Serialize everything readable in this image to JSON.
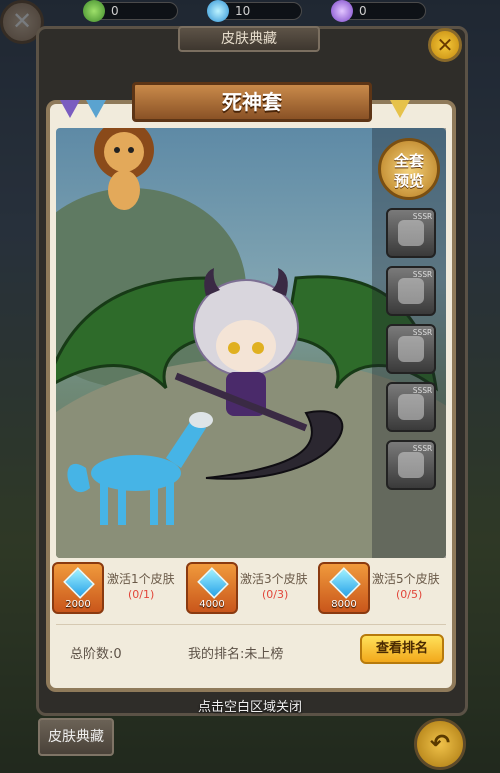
{
  "currencies": [
    {
      "icon": "clover-coin-icon",
      "value": "0"
    },
    {
      "icon": "diamond-icon",
      "value": "10"
    },
    {
      "icon": "purple-gem-icon",
      "value": "0"
    }
  ],
  "outer": {
    "title": "皮肤典藏"
  },
  "modal": {
    "title": "死神套"
  },
  "preview": {
    "label_line1": "全套",
    "label_line2": "预览"
  },
  "thumbs": [
    {
      "tag": "SSSR",
      "icon": "character-part-icon"
    },
    {
      "tag": "SSSR",
      "icon": "scythe-part-icon"
    },
    {
      "tag": "SSSR",
      "icon": "steed-part-icon"
    },
    {
      "tag": "SSSR",
      "icon": "wings-part-icon"
    },
    {
      "tag": "SSSR",
      "icon": "bear-part-icon"
    }
  ],
  "rewards": [
    {
      "amount": "2000",
      "label": "激活1个皮肤",
      "progress": "(0/1)"
    },
    {
      "amount": "4000",
      "label": "激活3个皮肤",
      "progress": "(0/3)"
    },
    {
      "amount": "8000",
      "label": "激活5个皮肤",
      "progress": "(0/5)"
    }
  ],
  "stats": {
    "total": "总阶数:0",
    "rank": "我的排名:未上榜"
  },
  "rank_button": "查看排名",
  "hint": "点击空白区域关闭",
  "bottom_tab": "皮肤典藏",
  "colors": {
    "accent": "#f2a81b",
    "progress": "#e2463a",
    "banner": "#a8683a"
  }
}
